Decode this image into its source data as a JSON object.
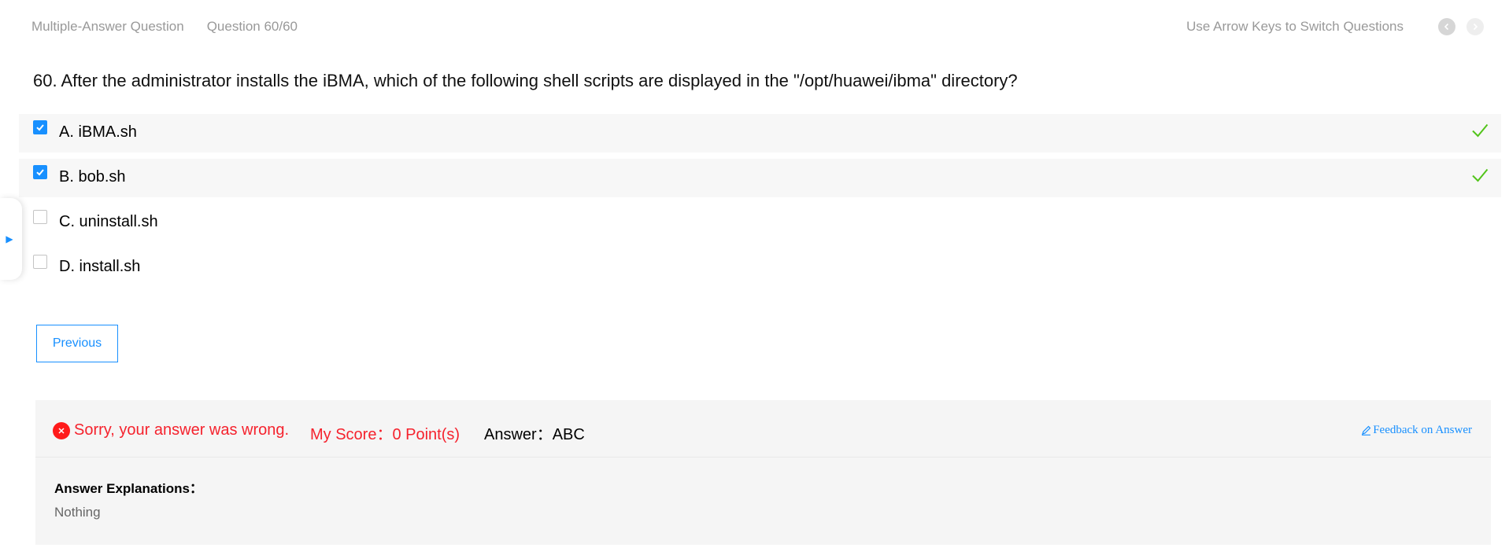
{
  "header": {
    "question_type": "Multiple-Answer Question",
    "question_counter": "Question 60/60",
    "nav_hint": "Use Arrow Keys to Switch Questions",
    "prev_icon": "chevron-left-icon",
    "next_icon": "chevron-right-icon"
  },
  "question": {
    "title": "60. After the administrator installs the iBMA, which of the following shell scripts are displayed in the \"/opt/huawei/ibma\" directory?",
    "options": [
      {
        "label": "A. iBMA.sh",
        "checked": true,
        "correct": true
      },
      {
        "label": "B. bob.sh",
        "checked": true,
        "correct": true
      },
      {
        "label": "C. uninstall.sh",
        "checked": false,
        "correct": false
      },
      {
        "label": "D. install.sh",
        "checked": false,
        "correct": false
      }
    ]
  },
  "side_panel": {
    "toggle_icon": "triangle-right-icon"
  },
  "controls": {
    "previous_label": "Previous"
  },
  "result": {
    "status_icon": "x-circle-icon",
    "status_text": "Sorry, your answer was wrong.",
    "score_text": "My Score：0 Point(s)",
    "answer_text": "Answer：ABC",
    "feedback_icon": "edit-icon",
    "feedback_label": "Feedback on Answer",
    "explanation_heading": "Answer Explanations：",
    "explanation_body": "Nothing"
  },
  "colors": {
    "accent": "#1890ff",
    "error": "#f5222d",
    "correct": "#52c41a",
    "muted_text": "#999999",
    "panel_bg": "#f5f5f5"
  }
}
